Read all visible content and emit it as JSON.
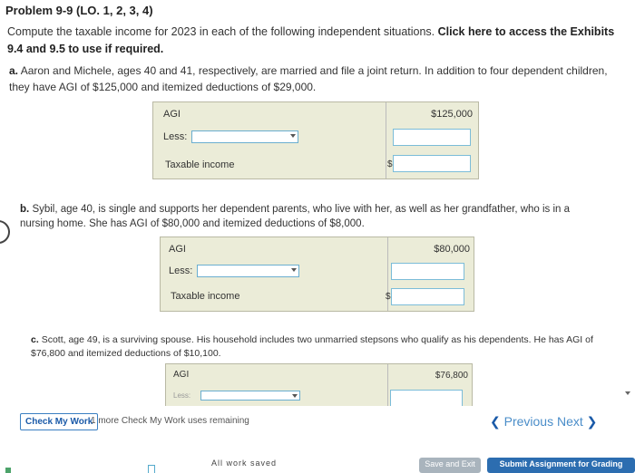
{
  "problem": {
    "title": "Problem 9-9 (LO. 1, 2, 3, 4)",
    "intro_text": "Compute the taxable income for 2023 in each of the following independent situations. ",
    "intro_link": "Click here to access the Exhibits 9.4 and 9.5 to use if required."
  },
  "part_a": {
    "text_prefix": "a.",
    "text": "Aaron and Michele, ages 40 and 41, respectively, are married and file a joint return. In addition to four dependent children, they have AGI of $125,000 and itemized deductions of $29,000.",
    "agi_label": "AGI",
    "agi_value": "$125,000",
    "less_label": "Less:",
    "less_input_value": "",
    "taxable_label": "Taxable income",
    "dollar_sign": "$",
    "taxable_input_value": ""
  },
  "part_b": {
    "text_prefix": "b.",
    "text": "Sybil, age 40, is single and supports her dependent parents, who live with her, as well as her grandfather, who is in a nursing home. She has AGI of $80,000 and itemized deductions of $8,000.",
    "agi_label": "AGI",
    "agi_value": "$80,000",
    "less_label": "Less:",
    "less_input_value": "",
    "taxable_label": "Taxable income",
    "dollar_sign": "$",
    "taxable_input_value": ""
  },
  "part_c": {
    "text_prefix": "c.",
    "text": "Scott, age 49, is a surviving spouse. His household includes two unmarried stepsons who qualify as his dependents. He has AGI of $76,800 and itemized deductions of $10,100.",
    "agi_label": "AGI",
    "agi_value": "$76,800",
    "less_label": "Less:"
  },
  "footer": {
    "check_my_work": "Check My Work",
    "remaining": "1 more Check My Work uses remaining",
    "previous": "Previous",
    "next": "Next",
    "all_work_saved": "All work saved",
    "save_and_exit": "Save and Exit",
    "submit": "Submit Assignment for Grading"
  },
  "colors": {
    "panel_bg": "#ebecd8",
    "accent_blue": "#1a5aa8",
    "input_border": "#7bbcd8"
  }
}
